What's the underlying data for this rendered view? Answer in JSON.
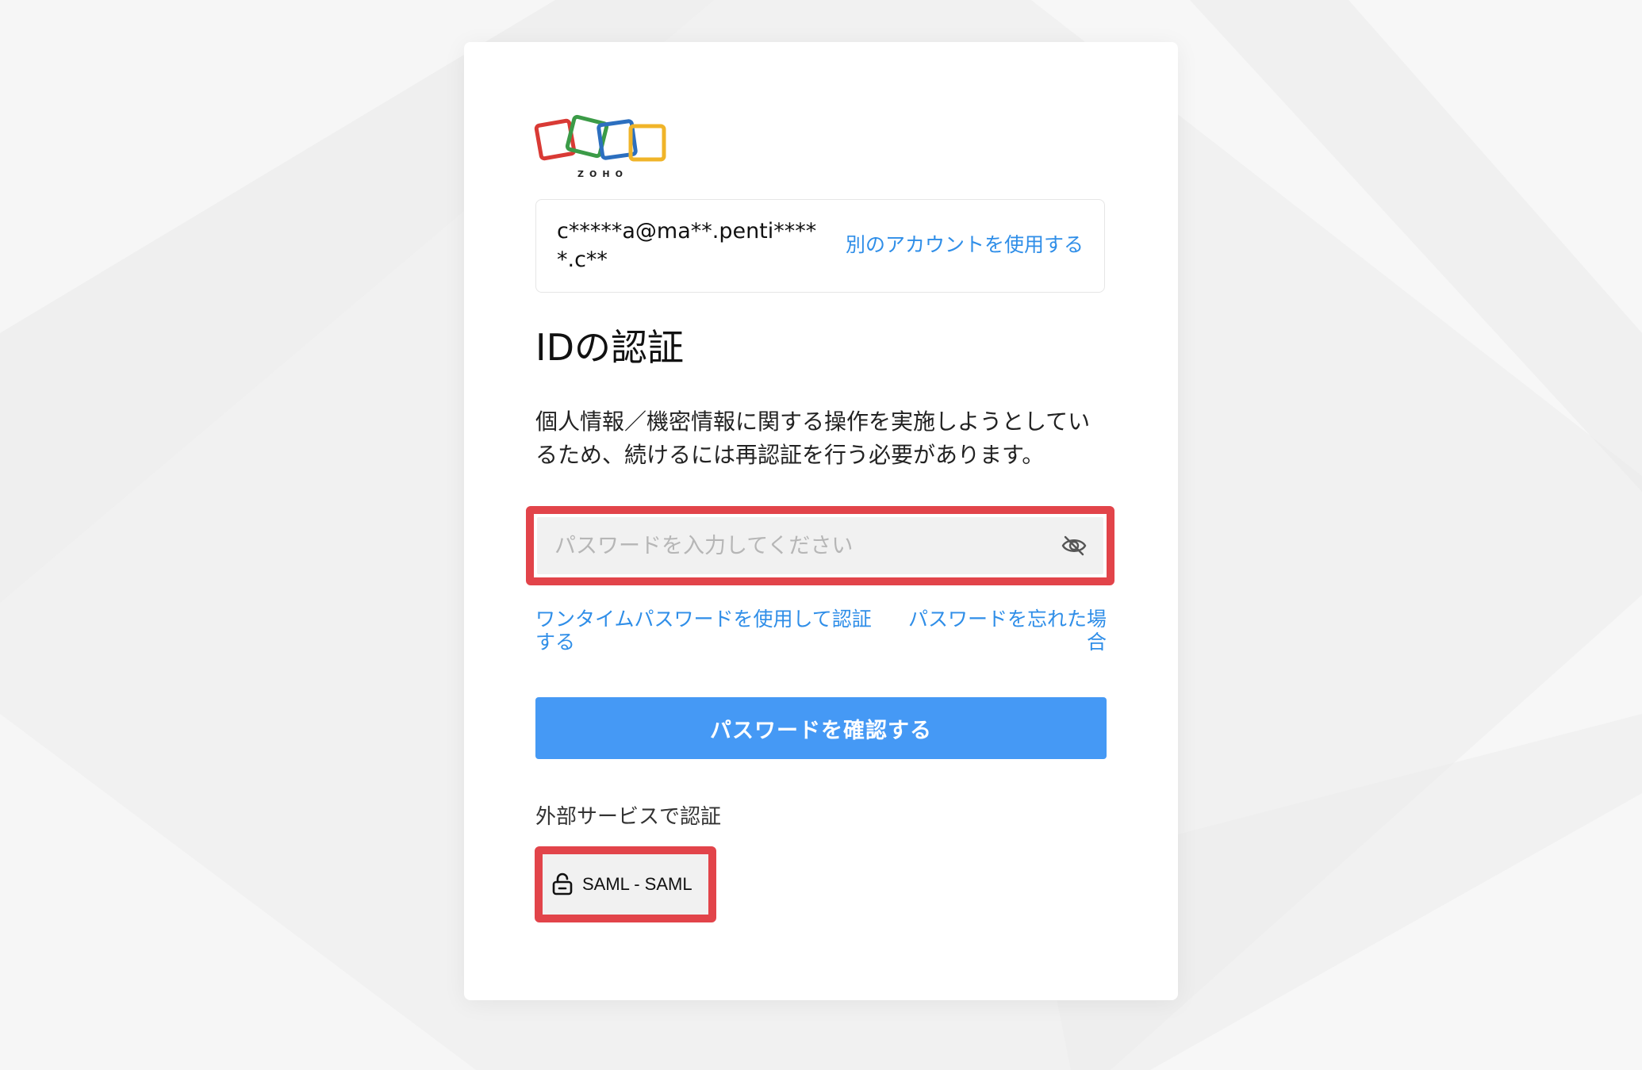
{
  "brand": {
    "logo_text": "ZOHO",
    "colors": [
      "#d93a35",
      "#3b9b47",
      "#2c6fbf",
      "#f0b429"
    ]
  },
  "account": {
    "email": "c*****a@ma**.penti*****.c**",
    "switch_link": "別のアカウントを使用する"
  },
  "heading": "IDの認証",
  "description": "個人情報／機密情報に関する操作を実施しようとしているため、続けるには再認証を行う必要があります。",
  "password": {
    "placeholder": "パスワードを入力してください",
    "value": "",
    "toggle_icon": "eye-slash-icon"
  },
  "links": {
    "otp": "ワンタイムパスワードを使用して認証する",
    "forgot": "パスワードを忘れた場合"
  },
  "confirm_button": "パスワードを確認する",
  "external": {
    "label": "外部サービスで認証",
    "saml_button": "SAML - SAML",
    "saml_icon": "unlock-icon"
  },
  "highlight_color": "#e2444a",
  "accent_color": "#4599f5",
  "link_color": "#2f8ee8"
}
